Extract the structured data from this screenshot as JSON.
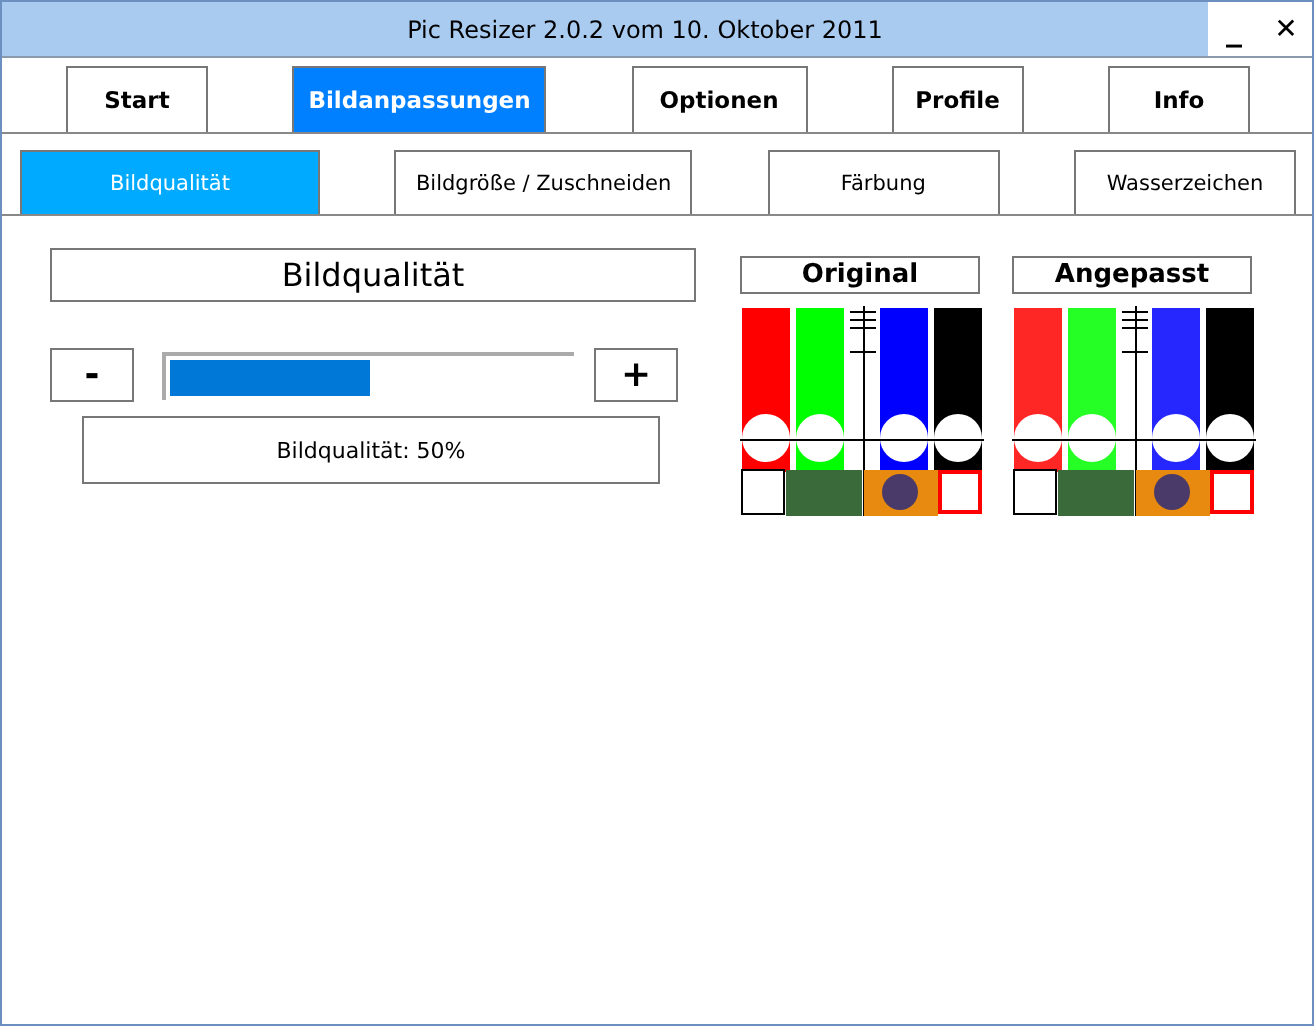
{
  "window": {
    "title": "Pic Resizer 2.0.2 vom 10. Oktober 2011",
    "controls": [
      {
        "kind": "minimize",
        "label": "_"
      },
      {
        "kind": "close",
        "label": "✕"
      }
    ]
  },
  "main_tabs": [
    {
      "label": "Start",
      "selected": false
    },
    {
      "label": "Bildanpassungen",
      "selected": true
    },
    {
      "label": "Optionen",
      "selected": false
    },
    {
      "label": "Profile",
      "selected": false
    },
    {
      "label": "Info",
      "selected": false
    }
  ],
  "sub_tabs": [
    {
      "label": "Bildqualität",
      "selected": true
    },
    {
      "label": "Bildgröße / Zuschneiden",
      "selected": false
    },
    {
      "label": "Färbung",
      "selected": false
    },
    {
      "label": "Wasserzeichen",
      "selected": false
    }
  ],
  "quality": {
    "heading": "Bildqualität",
    "decrease": "-",
    "increase": "+",
    "level": 0.5,
    "reading": "Bildqualität: 50%"
  },
  "previews": [
    {
      "label": "Original",
      "kind": "picture"
    },
    {
      "label": "Angepasst",
      "kind": "picture"
    }
  ]
}
